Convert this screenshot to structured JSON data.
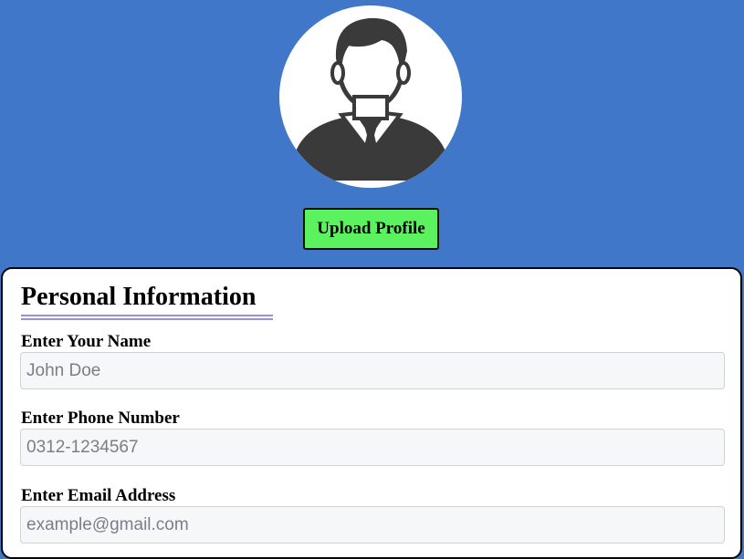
{
  "profile": {
    "avatar_icon": "user-avatar-icon",
    "upload_label": "Upload Profile"
  },
  "personal_info": {
    "title": "Personal Information",
    "fields": [
      {
        "label": "Enter Your Name",
        "placeholder": "John Doe",
        "value": ""
      },
      {
        "label": "Enter Phone Number",
        "placeholder": "0312-1234567",
        "value": ""
      },
      {
        "label": "Enter Email Address",
        "placeholder": "example@gmail.com",
        "value": ""
      }
    ]
  },
  "colors": {
    "background": "#4177c9",
    "upload_button": "#5cf25f",
    "underline": "#9b8ee3"
  }
}
